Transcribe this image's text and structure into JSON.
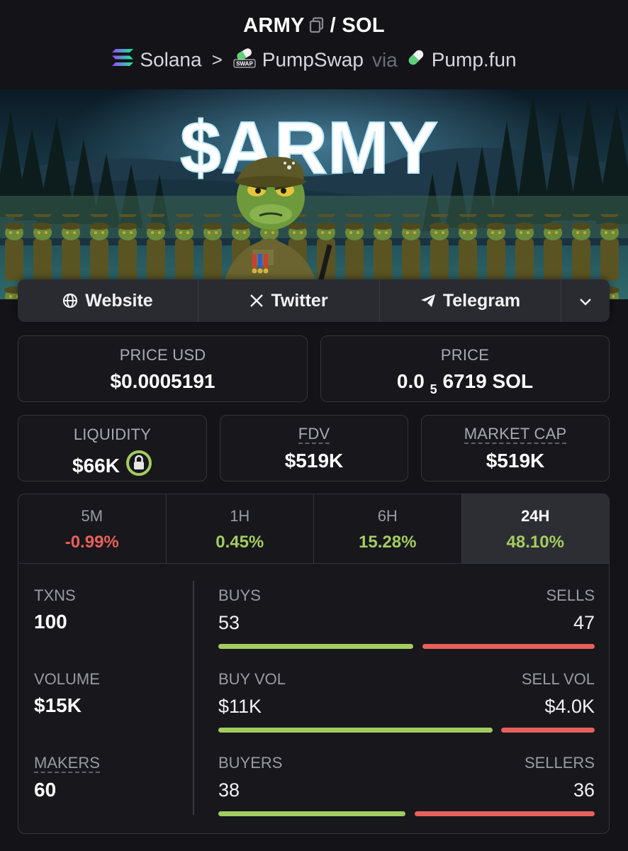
{
  "header": {
    "token": "ARMY",
    "separator": "/",
    "quote": "SOL",
    "chain": "Solana",
    "dex": "PumpSwap",
    "dex_icon_text": "SWAP",
    "via": "via",
    "launchpad": "Pump.fun"
  },
  "banner": {
    "title": "$ARMY"
  },
  "links": {
    "website": "Website",
    "twitter": "Twitter",
    "telegram": "Telegram"
  },
  "price_usd": {
    "label": "PRICE USD",
    "value": "$0.0005191"
  },
  "price": {
    "label": "PRICE",
    "value_prefix": "0.0",
    "value_sub": "5",
    "value_suffix": "6719 SOL"
  },
  "liquidity": {
    "label": "LIQUIDITY",
    "value": "$66K"
  },
  "fdv": {
    "label": "FDV",
    "value": "$519K"
  },
  "market_cap": {
    "label": "MARKET CAP",
    "value": "$519K"
  },
  "timeframes": [
    {
      "label": "5M",
      "change": "-0.99%"
    },
    {
      "label": "1H",
      "change": "0.45%"
    },
    {
      "label": "6H",
      "change": "15.28%"
    },
    {
      "label": "24H",
      "change": "48.10%"
    }
  ],
  "txns": {
    "label": "TXNS",
    "value": "100"
  },
  "volume": {
    "label": "VOLUME",
    "value": "$15K"
  },
  "makers": {
    "label": "MAKERS",
    "value": "60"
  },
  "buys_sells": {
    "left_label": "BUYS",
    "right_label": "SELLS",
    "left_value": "53",
    "right_value": "47",
    "buy_fraction": 0.53
  },
  "vol_split": {
    "left_label": "BUY VOL",
    "right_label": "SELL VOL",
    "left_value": "$11K",
    "right_value": "$4.0K",
    "buy_fraction": 0.74
  },
  "buyers_sellers": {
    "left_label": "BUYERS",
    "right_label": "SELLERS",
    "left_value": "38",
    "right_value": "36",
    "buy_fraction": 0.51
  },
  "colors": {
    "positive": "#a3cc5f",
    "negative": "#e8605a",
    "background": "#131318"
  }
}
